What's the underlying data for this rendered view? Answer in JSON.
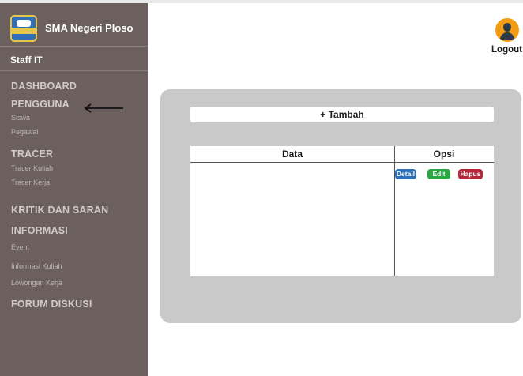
{
  "colors": {
    "sidebar_bg": "#6b605d",
    "panel_bg": "#c9c9c9",
    "detail_button": "#2e6fb7",
    "edit_button": "#27a844",
    "hapus_button": "#b5283a",
    "avatar_bg": "#f39c12"
  },
  "sidebar": {
    "school_name": "SMA Negeri Ploso",
    "role": "Staff IT",
    "menu": {
      "dashboard": "DASHBOARD",
      "pengguna": "PENGGUNA",
      "siswa": "Siswa",
      "pegawai": "Pegawai",
      "tracer": "TRACER",
      "tracer_kuliah": "Tracer Kuliah",
      "tracer_kerja": "Tracer Kerja",
      "kritik_saran": "KRITIK DAN SARAN",
      "informasi": "INFORMASI",
      "event": "Event",
      "informasi_kuliah": "Informasi Kuliah",
      "lowongan_kerja": "Lowongan Kerja",
      "forum_diskusi": "FORUM DISKUSI"
    }
  },
  "header": {
    "avatar_icon": "user-avatar-icon",
    "logout_label": "Logout"
  },
  "main": {
    "add_button_label": "+ Tambah",
    "table": {
      "columns": [
        "Data",
        "Opsi"
      ],
      "actions": {
        "detail": "Detail",
        "edit": "Edit",
        "hapus": "Hapus"
      }
    }
  },
  "annotation": {
    "arrow_icon": "left-arrow-icon"
  }
}
